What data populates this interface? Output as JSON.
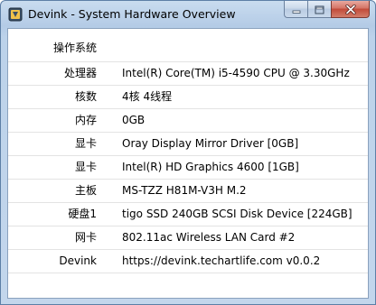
{
  "window": {
    "title": "Devink - System Hardware Overview",
    "icon": "devink-app-icon"
  },
  "caption_buttons": {
    "minimize_icon": "minimize-icon",
    "maximize_icon": "maximize-icon",
    "close_icon": "close-icon"
  },
  "rows": [
    {
      "label": "操作系统",
      "value": ""
    },
    {
      "label": "处理器",
      "value": "Intel(R) Core(TM) i5-4590 CPU @ 3.30GHz"
    },
    {
      "label": "核数",
      "value": "4核 4线程"
    },
    {
      "label": "内存",
      "value": "0GB"
    },
    {
      "label": "显卡",
      "value": "Oray Display Mirror Driver [0GB]"
    },
    {
      "label": "显卡",
      "value": "Intel(R) HD Graphics 4600 [1GB]"
    },
    {
      "label": "主板",
      "value": "MS-TZZ H81M-V3H M.2"
    },
    {
      "label": "硬盘1",
      "value": "tigo SSD 240GB SCSI Disk Device [224GB]"
    },
    {
      "label": "网卡",
      "value": "802.11ac Wireless LAN Card #2"
    },
    {
      "label": "Devink",
      "value": "https://devink.techartlife.com v0.0.2"
    }
  ],
  "colors": {
    "title_bar": "#b4cbe6",
    "close_button": "#c24a39",
    "row_divider": "#e3e3e3"
  }
}
